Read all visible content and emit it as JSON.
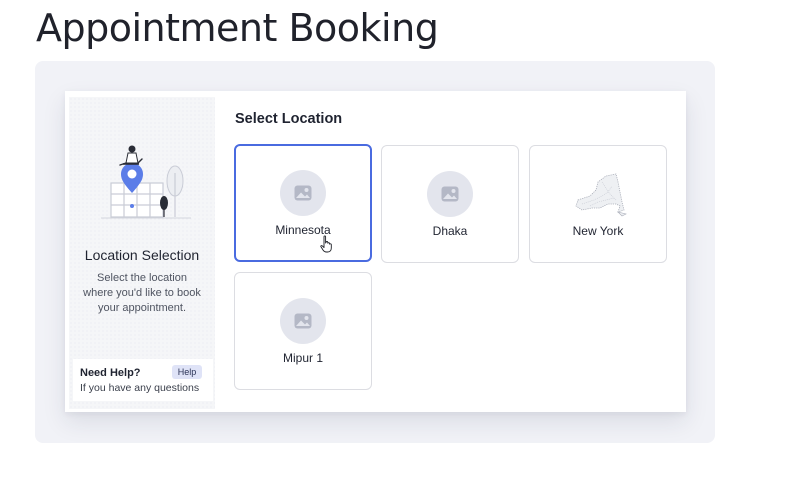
{
  "page": {
    "title": "Appointment Booking"
  },
  "sidebar": {
    "illustration_icon": "location-pin-map-icon",
    "title": "Location Selection",
    "description": "Select the location where you'd like to book your appointment.",
    "help": {
      "title": "Need Help?",
      "badge": "Help",
      "text": "If you have any questions"
    }
  },
  "main": {
    "heading": "Select Location",
    "locations": [
      {
        "label": "Minnesota",
        "icon": "image-placeholder-icon",
        "selected": true
      },
      {
        "label": "Dhaka",
        "icon": "image-placeholder-icon",
        "selected": false
      },
      {
        "label": "New York",
        "icon": "new-york-map-icon",
        "selected": false
      },
      {
        "label": "Mipur 1",
        "icon": "image-placeholder-icon",
        "selected": false
      }
    ]
  },
  "colors": {
    "accent": "#4a6be0",
    "pin": "#5b7de8",
    "backdrop": "#f1f2f7",
    "icon_circle": "#e3e5ed"
  }
}
